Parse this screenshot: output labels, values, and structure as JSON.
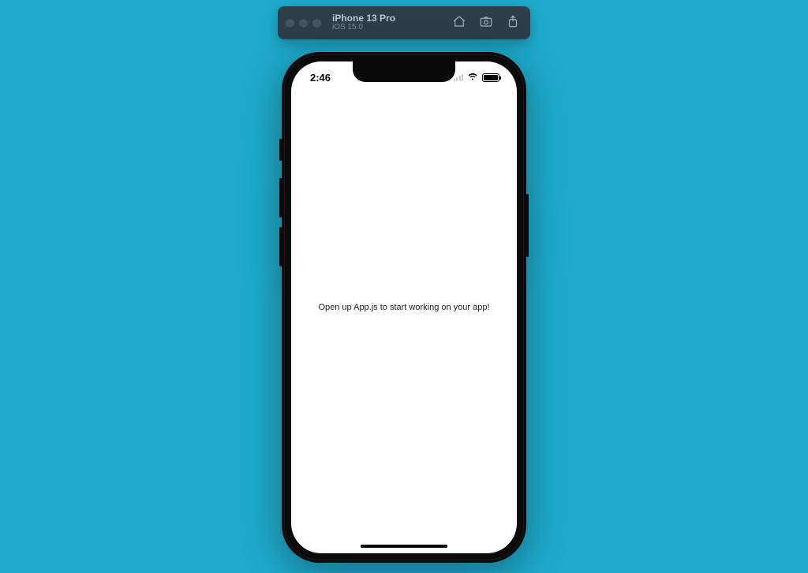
{
  "toolbar": {
    "device_name": "iPhone 13 Pro",
    "os_version": "iOS 15.0",
    "icons": {
      "home": "home-icon",
      "screenshot": "camera-icon",
      "rotate": "rotate-icon"
    }
  },
  "status_bar": {
    "time": "2:46"
  },
  "app": {
    "message": "Open up App.js to start working on your app!"
  },
  "colors": {
    "background": "#1eaacc",
    "toolbar": "#2d3e4a"
  }
}
